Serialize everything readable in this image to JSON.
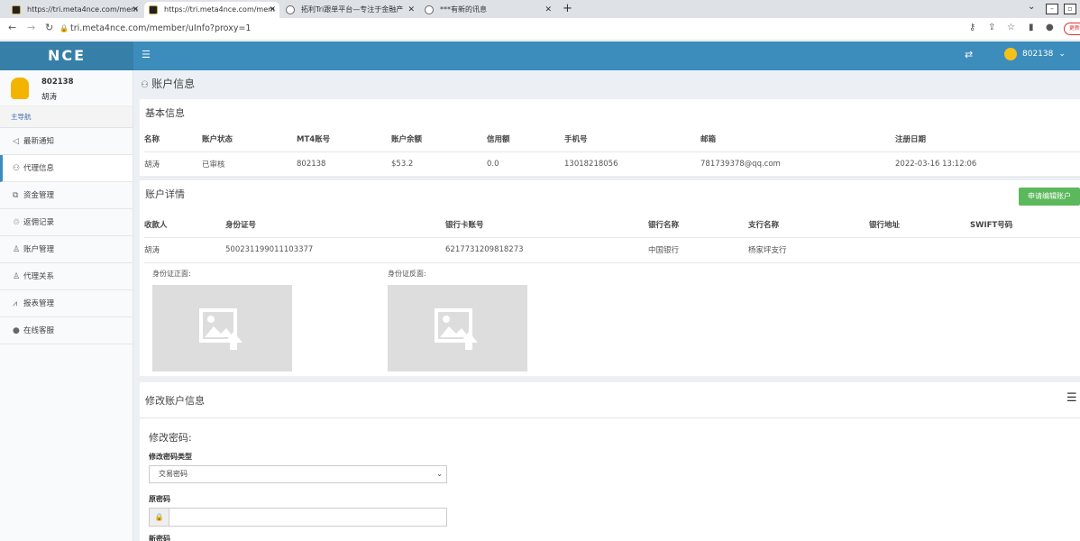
{
  "browser": {
    "tabs": [
      {
        "title": "https://tri.meta4nce.com/mem",
        "active": false,
        "icon": "nce-favicon"
      },
      {
        "title": "https://tri.meta4nce.com/mem",
        "active": true,
        "icon": "nce-favicon"
      },
      {
        "title": "拓利Tri跟单平台—专注于金融产",
        "active": false,
        "icon": "globe-icon"
      },
      {
        "title": "***有新的讯息",
        "active": false,
        "icon": "globe-icon"
      }
    ],
    "url": "tri.meta4nce.com/member/uInfo?proxy=1",
    "badge": "更新"
  },
  "app": {
    "logo": "NCE",
    "header_user": "802138"
  },
  "sidebar": {
    "user_id": "802138",
    "user_name": "胡涛",
    "nav_header": "主导航",
    "items": [
      {
        "label": "最新通知",
        "icon": "speaker-icon"
      },
      {
        "label": "代理信息",
        "icon": "users-icon"
      },
      {
        "label": "资金管理",
        "icon": "copy-icon"
      },
      {
        "label": "返佣记录",
        "icon": "recycle-icon"
      },
      {
        "label": "账户管理",
        "icon": "user-icon"
      },
      {
        "label": "代理关系",
        "icon": "user-icon"
      },
      {
        "label": "报表管理",
        "icon": "chart-icon"
      },
      {
        "label": "在线客服",
        "icon": "person-icon"
      }
    ]
  },
  "page": {
    "title": "账户信息",
    "basic": {
      "heading": "基本信息",
      "columns": [
        "名称",
        "账户状态",
        "MT4账号",
        "账户余额",
        "信用额",
        "手机号",
        "邮箱",
        "注册日期"
      ],
      "row": [
        "胡涛",
        "已审核",
        "802138",
        "$53.2",
        "0.0",
        "13018218056",
        "781739378@qq.com",
        "2022-03-16 13:12:06"
      ]
    },
    "details": {
      "heading": "账户详情",
      "apply_label": "申请编辑账户",
      "columns": [
        "收款人",
        "身份证号",
        "银行卡账号",
        "银行名称",
        "支行名称",
        "银行地址",
        "SWIFT号码"
      ],
      "row": [
        "胡涛",
        "500231199011103377",
        "6217731209818273",
        "中国银行",
        "杨家坪支行",
        "",
        ""
      ],
      "id_front": "身份证正面:",
      "id_back": "身份证反面:"
    },
    "modify": {
      "heading": "修改账户信息",
      "pwd_title": "修改密码:",
      "type_label": "修改密码类型",
      "type_value": "交易密码",
      "orig_label": "原密码",
      "new_label": "新密码"
    }
  }
}
